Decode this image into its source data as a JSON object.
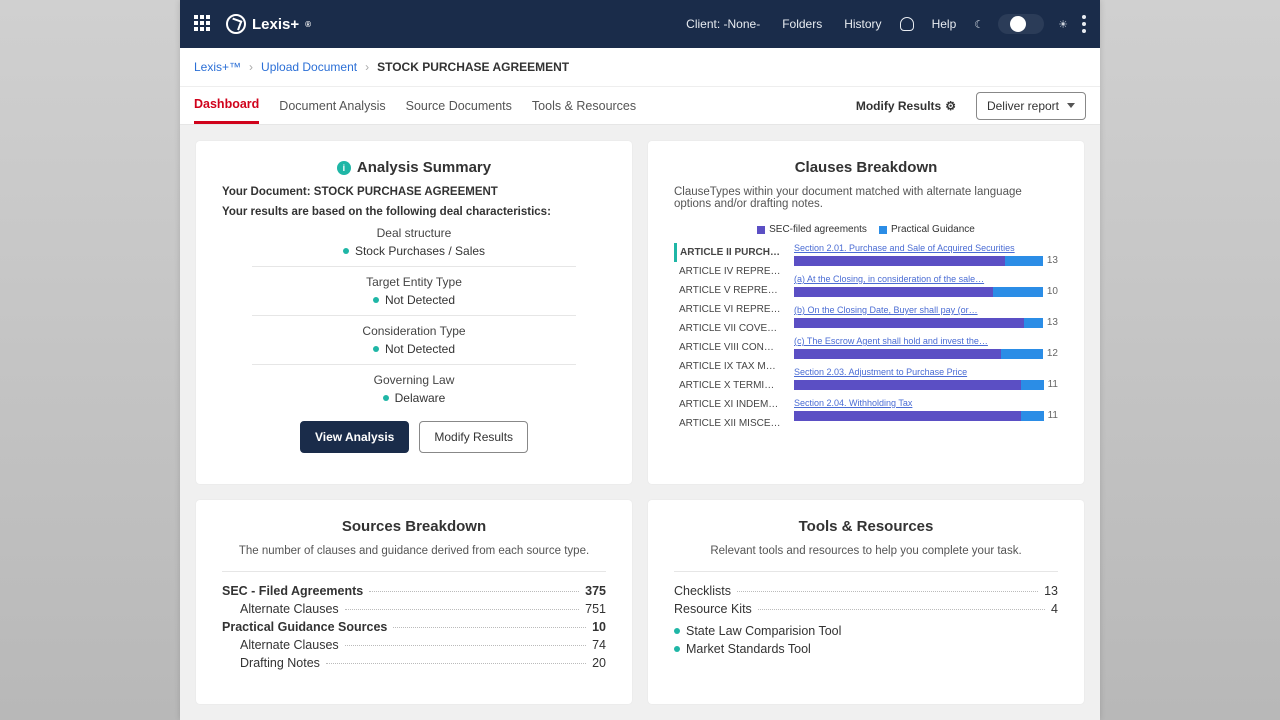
{
  "brand": "Lexis+",
  "topbar": {
    "client_label": "Client:",
    "client_value": "-None-",
    "folders": "Folders",
    "history": "History",
    "help": "Help"
  },
  "breadcrumbs": {
    "root": "Lexis+™",
    "mid": "Upload Document",
    "current": "STOCK PURCHASE AGREEMENT"
  },
  "tabs": {
    "dashboard": "Dashboard",
    "doc_analysis": "Document Analysis",
    "source_docs": "Source Documents",
    "tools": "Tools & Resources",
    "modify": "Modify Results",
    "deliver": "Deliver report"
  },
  "analysis": {
    "title": "Analysis Summary",
    "your_doc_label": "Your Document:",
    "your_doc_name": "STOCK PURCHASE AGREEMENT",
    "based_on": "Your results are based on the following deal characteristics:",
    "rows": [
      {
        "label": "Deal structure",
        "value": "Stock Purchases / Sales"
      },
      {
        "label": "Target Entity Type",
        "value": "Not Detected"
      },
      {
        "label": "Consideration Type",
        "value": "Not Detected"
      },
      {
        "label": "Governing Law",
        "value": "Delaware"
      }
    ],
    "view_btn": "View Analysis",
    "modify_btn": "Modify Results"
  },
  "clauses": {
    "title": "Clauses Breakdown",
    "desc": "ClauseTypes within your document matched with alternate language options and/or drafting notes.",
    "legend": {
      "a": "SEC-filed agreements",
      "b": "Practical Guidance"
    },
    "articles": [
      "ARTICLE II PURCH…",
      "ARTICLE IV REPRE…",
      "ARTICLE V REPRES…",
      "ARTICLE VI REPRE…",
      "ARTICLE VII COVE…",
      "ARTICLE VIII CON…",
      "ARTICLE IX TAX M…",
      "ARTICLE X TERMI…",
      "ARTICLE XI INDEM…",
      "ARTICLE XII MISCE…"
    ]
  },
  "chart_data": {
    "type": "bar",
    "orientation": "horizontal",
    "categories": [
      "Section 2.01. Purchase and Sale of Acquired Securities",
      "(a) At the Closing, in consideration of the sale…",
      "(b) On the Closing Date, Buyer shall pay (or…",
      "(c) The Escrow Agent shall hold and invest the…",
      "Section 2.03. Adjustment to Purchase Price",
      "Section 2.04. Withholding Tax"
    ],
    "series": [
      {
        "name": "SEC-filed agreements",
        "color": "#5b4fc4",
        "values": [
          11,
          8,
          12,
          10,
          10,
          10
        ]
      },
      {
        "name": "Practical Guidance",
        "color": "#2b8de6",
        "values": [
          2,
          2,
          1,
          2,
          1,
          1
        ]
      }
    ],
    "totals": [
      13,
      10,
      13,
      12,
      11,
      11
    ],
    "xlabel": "",
    "ylabel": "",
    "max": 14
  },
  "sources": {
    "title": "Sources Breakdown",
    "desc": "The number of clauses and guidance derived from each source type.",
    "rows": [
      {
        "label": "SEC - Filed Agreements",
        "value": "375",
        "bold": true
      },
      {
        "label": "Alternate Clauses",
        "value": "751",
        "bold": false,
        "sub": true
      },
      {
        "label": "Practical Guidance Sources",
        "value": "10",
        "bold": true
      },
      {
        "label": "Alternate Clauses",
        "value": "74",
        "bold": false,
        "sub": true
      },
      {
        "label": "Drafting Notes",
        "value": "20",
        "bold": false,
        "sub": true
      }
    ]
  },
  "tools": {
    "title": "Tools & Resources",
    "desc": "Relevant tools and resources to help you complete your task.",
    "rows": [
      {
        "label": "Checklists",
        "value": "13"
      },
      {
        "label": "Resource Kits",
        "value": "4"
      }
    ],
    "links": [
      "State Law Comparision Tool",
      "Market Standards Tool"
    ]
  }
}
